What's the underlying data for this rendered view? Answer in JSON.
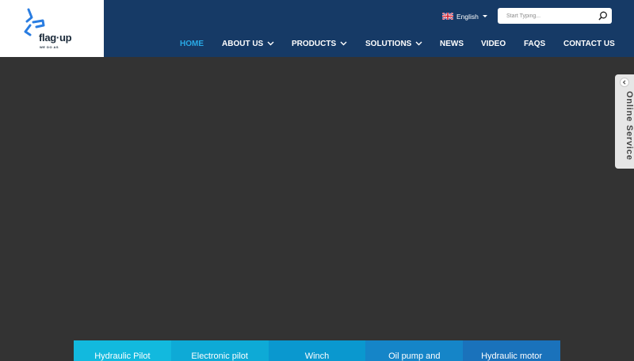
{
  "header": {
    "logo": {
      "text": "flag·up",
      "subtext": "WE DO AS"
    },
    "language": {
      "label": "English",
      "flag_icon": "uk-flag-icon"
    },
    "search": {
      "placeholder": "Start Typing...",
      "icon": "search-icon"
    },
    "nav": [
      {
        "label": "HOME",
        "active": true,
        "dropdown": false
      },
      {
        "label": "ABOUT US",
        "active": false,
        "dropdown": true
      },
      {
        "label": "PRODUCTS",
        "active": false,
        "dropdown": true
      },
      {
        "label": "SOLUTIONS",
        "active": false,
        "dropdown": true
      },
      {
        "label": "NEWS",
        "active": false,
        "dropdown": false
      },
      {
        "label": "VIDEO",
        "active": false,
        "dropdown": false
      },
      {
        "label": "FAQS",
        "active": false,
        "dropdown": false
      },
      {
        "label": "CONTACT US",
        "active": false,
        "dropdown": false
      }
    ]
  },
  "online_service": {
    "label": "Online Service",
    "close_icon": "chevron-left-icon"
  },
  "categories": [
    {
      "label": "Hydraulic Pilot",
      "color": "#12b9de"
    },
    {
      "label": "Electronic pilot",
      "color": "#0eaad6"
    },
    {
      "label": "Winch",
      "color": "#0a98cf"
    },
    {
      "label": "Oil pump and",
      "color": "#1585c8"
    },
    {
      "label": "Hydraulic motor",
      "color": "#1a72bb"
    }
  ],
  "colors": {
    "header_bg": "#163a66",
    "accent": "#29a9e6",
    "hero_bg": "#333333"
  }
}
